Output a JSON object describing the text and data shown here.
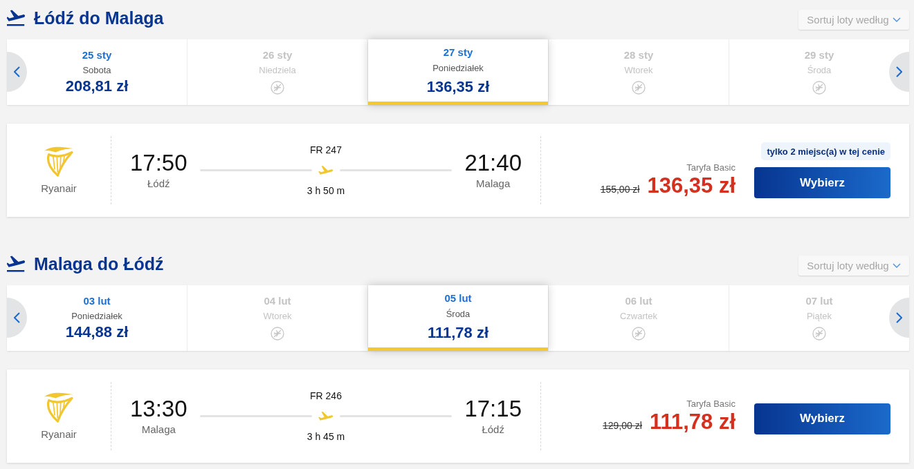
{
  "sections": [
    {
      "title": "Łódź do Malaga",
      "sort_label": "Sortuj loty według",
      "dates": [
        {
          "date": "25 sty",
          "weekday": "Sobota",
          "price": "208,81 zł",
          "available": true,
          "selected": false
        },
        {
          "date": "26 sty",
          "weekday": "Niedziela",
          "available": false,
          "selected": false
        },
        {
          "date": "27 sty",
          "weekday": "Poniedziałek",
          "price": "136,35 zł",
          "available": true,
          "selected": true
        },
        {
          "date": "28 sty",
          "weekday": "Wtorek",
          "available": false,
          "selected": false
        },
        {
          "date": "29 sty",
          "weekday": "Środa",
          "available": false,
          "selected": false
        }
      ],
      "flights": [
        {
          "airline": "Ryanair",
          "departure_time": "17:50",
          "departure_city": "Łódź",
          "flight_number": "FR 247",
          "duration": "3 h 50 m",
          "arrival_time": "21:40",
          "arrival_city": "Malaga",
          "fare": "Taryfa Basic",
          "old_price": "155,00 zł",
          "price": "136,35 zł",
          "seats_note": "tylko 2 miejsc(a) w tej cenie",
          "button": "Wybierz"
        }
      ]
    },
    {
      "title": "Malaga do Łódź",
      "sort_label": "Sortuj loty według",
      "dates": [
        {
          "date": "03 lut",
          "weekday": "Poniedziałek",
          "price": "144,88 zł",
          "available": true,
          "selected": false
        },
        {
          "date": "04 lut",
          "weekday": "Wtorek",
          "available": false,
          "selected": false
        },
        {
          "date": "05 lut",
          "weekday": "Środa",
          "price": "111,78 zł",
          "available": true,
          "selected": true
        },
        {
          "date": "06 lut",
          "weekday": "Czwartek",
          "available": false,
          "selected": false
        },
        {
          "date": "07 lut",
          "weekday": "Piątek",
          "available": false,
          "selected": false
        }
      ],
      "flights": [
        {
          "airline": "Ryanair",
          "departure_time": "13:30",
          "departure_city": "Malaga",
          "flight_number": "FR 246",
          "duration": "3 h 45 m",
          "arrival_time": "17:15",
          "arrival_city": "Łódź",
          "fare": "Taryfa Basic",
          "old_price": "129,00 zł",
          "price": "111,78 zł",
          "button": "Wybierz"
        }
      ]
    }
  ]
}
